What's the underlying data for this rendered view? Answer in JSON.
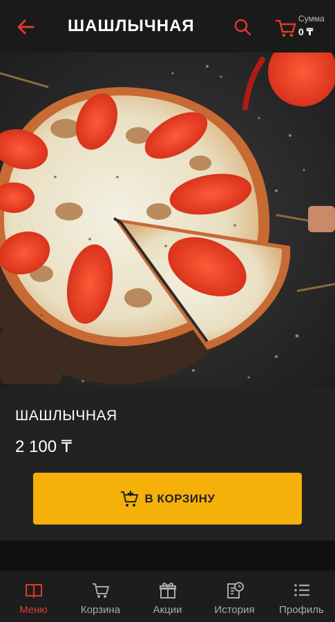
{
  "header": {
    "title": "ШАШЛЫЧНАЯ",
    "sum_label": "Сумма",
    "sum_value": "0 ₸"
  },
  "product": {
    "name": "ШАШЛЫЧНАЯ",
    "price": "2 100 ₸",
    "add_button_label": "В КОРЗИНУ"
  },
  "nav": {
    "items": [
      {
        "label": "Меню",
        "icon": "book-icon",
        "active": true
      },
      {
        "label": "Корзина",
        "icon": "cart-icon",
        "active": false
      },
      {
        "label": "Акции",
        "icon": "gift-icon",
        "active": false
      },
      {
        "label": "История",
        "icon": "history-icon",
        "active": false
      },
      {
        "label": "Профиль",
        "icon": "list-icon",
        "active": false
      }
    ]
  },
  "colors": {
    "accent": "#e03a2e",
    "button": "#f5b00a",
    "background": "#1a1a1a"
  }
}
